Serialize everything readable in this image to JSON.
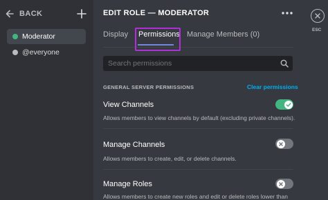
{
  "sidebar": {
    "back_label": "BACK",
    "roles": [
      {
        "label": "Moderator",
        "color": "#43b581",
        "active": true
      },
      {
        "label": "@everyone",
        "color": "#b9bbbe",
        "active": false
      }
    ]
  },
  "header": {
    "title": "EDIT ROLE — MODERATOR"
  },
  "tabs": [
    {
      "label": "Display",
      "active": false
    },
    {
      "label": "Permissions",
      "active": true
    },
    {
      "label": "Manage Members (0)",
      "active": false
    }
  ],
  "search": {
    "placeholder": "Search permissions"
  },
  "section": {
    "title": "GENERAL SERVER PERMISSIONS",
    "clear_label": "Clear permissions"
  },
  "permissions": [
    {
      "name": "View Channels",
      "description": "Allows members to view channels by default (excluding private channels).",
      "enabled": true
    },
    {
      "name": "Manage Channels",
      "description": "Allows members to create, edit, or delete channels.",
      "enabled": false
    },
    {
      "name": "Manage Roles",
      "description": "Allows members to create new roles and edit or delete roles lower than",
      "enabled": false
    }
  ],
  "close": {
    "esc_label": "ESC"
  },
  "colors": {
    "accent": "#7289da",
    "highlight": "#b12fd6",
    "toggle_on": "#43b581",
    "toggle_off": "#72767d",
    "link": "#00aff4"
  }
}
